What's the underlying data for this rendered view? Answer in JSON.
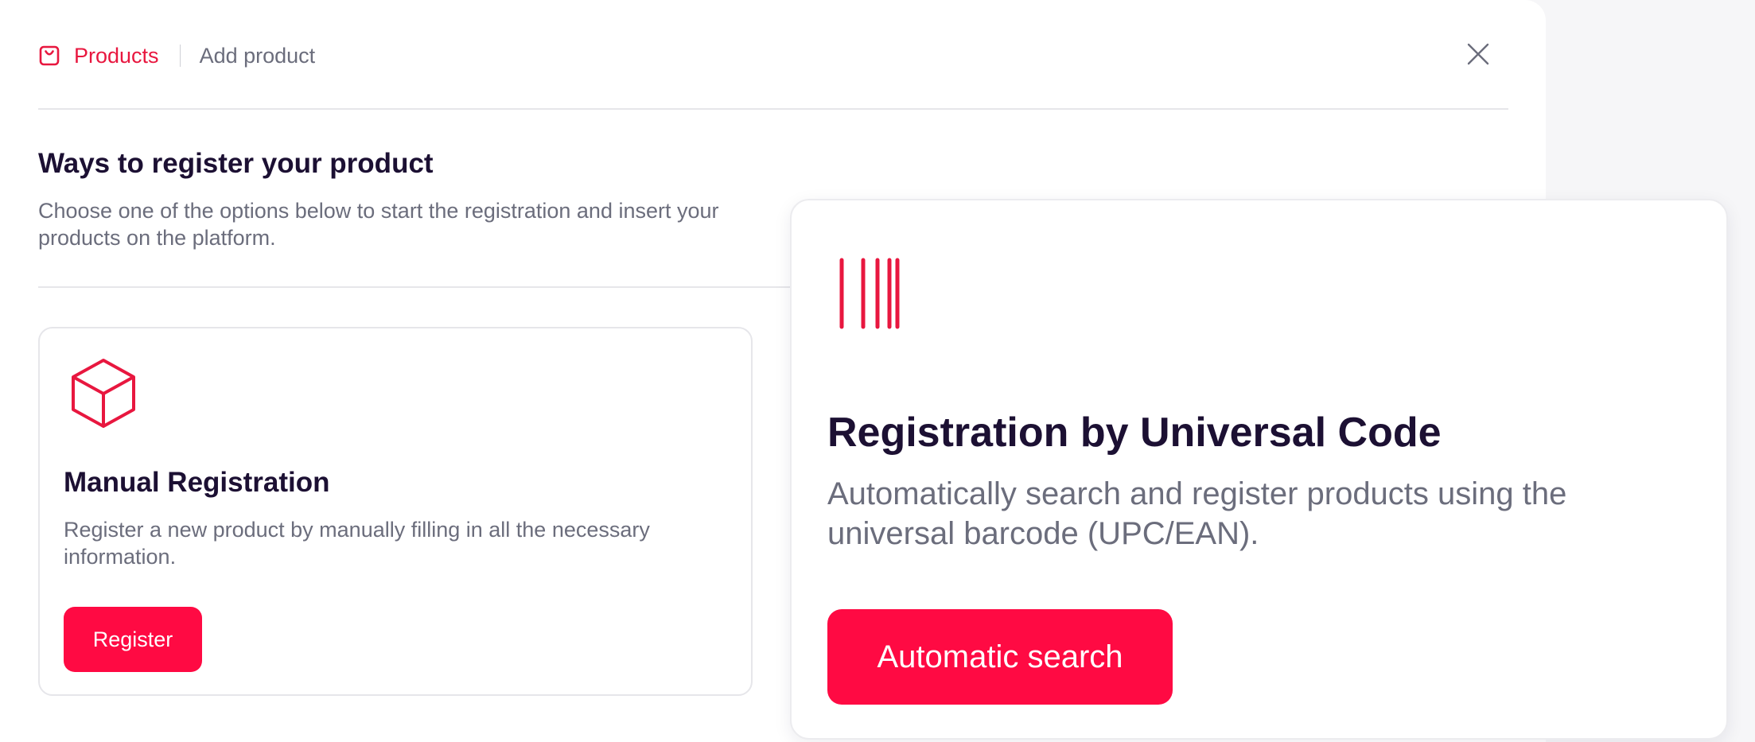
{
  "header": {
    "breadcrumb_root": "Products",
    "breadcrumb_current": "Add product",
    "root_icon": "shopping-bag-icon",
    "close_icon": "close-icon"
  },
  "section": {
    "title": "Ways to register your product",
    "description": "Choose one of the options below to start the registration and insert your products on the platform."
  },
  "manual_card": {
    "icon": "box-icon",
    "title": "Manual Registration",
    "description": "Register a new product by manually filling in all the necessary information.",
    "button_label": "Register"
  },
  "universal_card": {
    "icon": "barcode-icon",
    "title": "Registration by Universal Code",
    "description": "Automatically search and register products using the universal barcode (UPC/EAN).",
    "button_label": "Automatic search"
  },
  "colors": {
    "accent": "#ff0a43",
    "heading": "#1c1033",
    "muted_text": "#6b6d7c",
    "border": "#e6e6ea"
  }
}
